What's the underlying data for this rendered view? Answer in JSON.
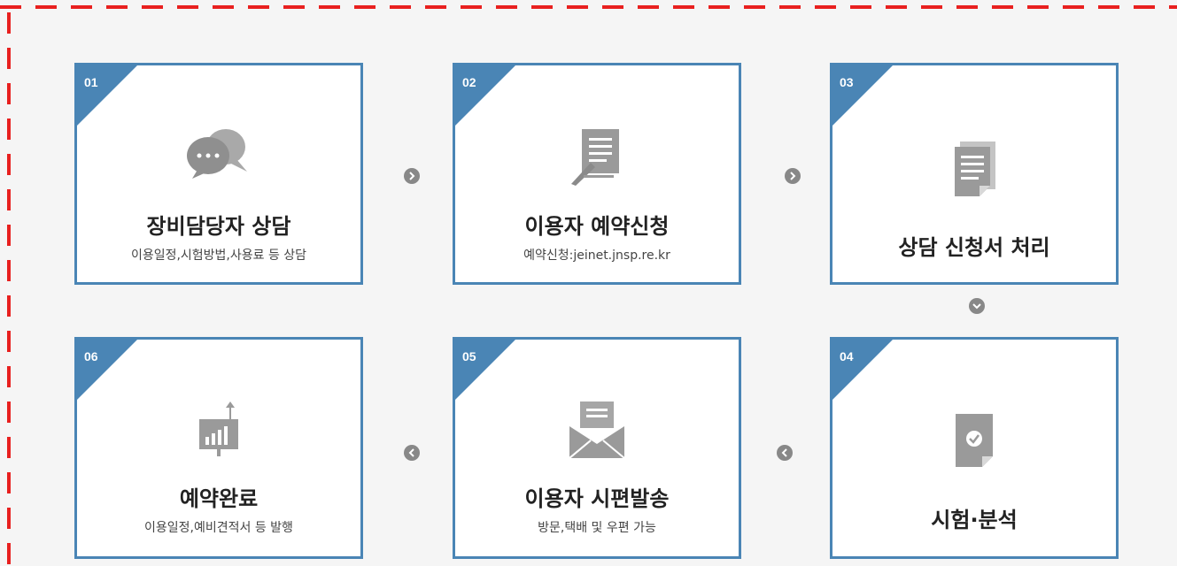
{
  "steps": [
    {
      "num": "01",
      "title": "장비담당자 상담",
      "sub": "이용일정,시험방법,사용료 등 상담",
      "icon": "chat-bubbles-icon"
    },
    {
      "num": "02",
      "title": "이용자 예약신청",
      "sub": "예약신청:jeinet.jnsp.re.kr",
      "icon": "document-pen-icon"
    },
    {
      "num": "03",
      "title": "상담 신청서 처리",
      "sub": "",
      "icon": "documents-icon"
    },
    {
      "num": "04",
      "title": "시험·분석",
      "sub": "",
      "icon": "check-document-icon"
    },
    {
      "num": "05",
      "title": "이용자 시편발송",
      "sub": "방문,택배 및 우편 가능",
      "icon": "envelope-icon"
    },
    {
      "num": "06",
      "title": "예약완료",
      "sub": "이용일정,예비견적서 등 발행",
      "icon": "chart-monitor-icon"
    }
  ],
  "colors": {
    "accent": "#4a85b5",
    "border-dash": "#e8201f",
    "icon": "#9a9a9a",
    "arrow": "#888888"
  }
}
